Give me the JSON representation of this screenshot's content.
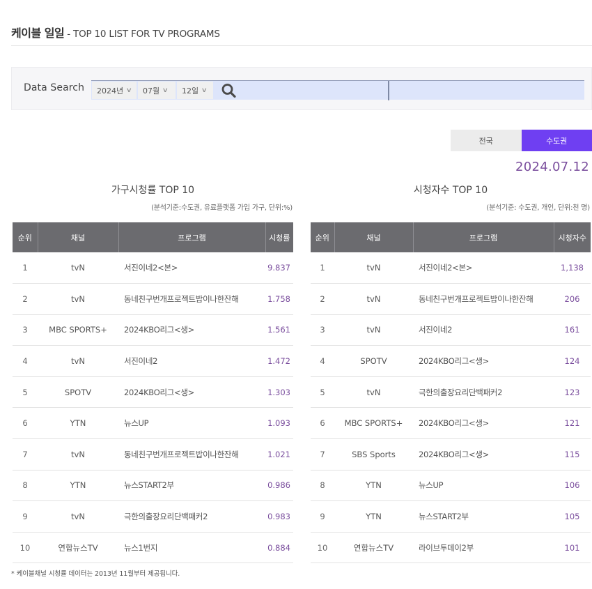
{
  "header": {
    "title": "케이블 일일",
    "subtitle": " - TOP 10 LIST FOR TV PROGRAMS"
  },
  "search": {
    "label": "Data Search",
    "year": "2024년",
    "month": "07월",
    "day": "12일",
    "search_icon": "search-icon"
  },
  "region_tabs": [
    {
      "label": "전국",
      "active": false
    },
    {
      "label": "수도권",
      "active": true
    }
  ],
  "date": "2024.07.12",
  "colors": {
    "accent_purple": "#6f3ff2",
    "value_purple": "#7b4f9e",
    "table_header": "#6b6b6f",
    "search_bar": "#dde5fb"
  },
  "household": {
    "title": "가구시청률 TOP 10",
    "note": "(분석기준:수도권, 유료플랫폼 가입 가구, 단위:%)",
    "columns": [
      "순위",
      "채널",
      "프로그램",
      "시청률"
    ],
    "rows": [
      {
        "rank": "1",
        "channel": "tvN",
        "program": "서진이네2<본>",
        "value": "9.837"
      },
      {
        "rank": "2",
        "channel": "tvN",
        "program": "동네친구번개프로젝트밥이나한잔해",
        "value": "1.758"
      },
      {
        "rank": "3",
        "channel": "MBC SPORTS+",
        "program": "2024KBO리그<생>",
        "value": "1.561"
      },
      {
        "rank": "4",
        "channel": "tvN",
        "program": "서진이네2",
        "value": "1.472"
      },
      {
        "rank": "5",
        "channel": "SPOTV",
        "program": "2024KBO리그<생>",
        "value": "1.303"
      },
      {
        "rank": "6",
        "channel": "YTN",
        "program": "뉴스UP",
        "value": "1.093"
      },
      {
        "rank": "7",
        "channel": "tvN",
        "program": "동네친구번개프로젝트밥이나한잔해",
        "value": "1.021"
      },
      {
        "rank": "8",
        "channel": "YTN",
        "program": "뉴스START2부",
        "value": "0.986"
      },
      {
        "rank": "9",
        "channel": "tvN",
        "program": "극한의출장요리단백패커2",
        "value": "0.983"
      },
      {
        "rank": "10",
        "channel": "연합뉴스TV",
        "program": "뉴스1번지",
        "value": "0.884"
      }
    ]
  },
  "viewers": {
    "title": "시청자수 TOP 10",
    "note": "(분석기준: 수도권, 개인, 단위:천 명)",
    "columns": [
      "순위",
      "채널",
      "프로그램",
      "시청자수"
    ],
    "rows": [
      {
        "rank": "1",
        "channel": "tvN",
        "program": "서진이네2<본>",
        "value": "1,138"
      },
      {
        "rank": "2",
        "channel": "tvN",
        "program": "동네친구번개프로젝트밥이나한잔해",
        "value": "206"
      },
      {
        "rank": "3",
        "channel": "tvN",
        "program": "서진이네2",
        "value": "161"
      },
      {
        "rank": "4",
        "channel": "SPOTV",
        "program": "2024KBO리그<생>",
        "value": "124"
      },
      {
        "rank": "5",
        "channel": "tvN",
        "program": "극한의출장요리단백패커2",
        "value": "123"
      },
      {
        "rank": "6",
        "channel": "MBC SPORTS+",
        "program": "2024KBO리그<생>",
        "value": "121"
      },
      {
        "rank": "7",
        "channel": "SBS Sports",
        "program": "2024KBO리그<생>",
        "value": "115"
      },
      {
        "rank": "8",
        "channel": "YTN",
        "program": "뉴스UP",
        "value": "106"
      },
      {
        "rank": "9",
        "channel": "YTN",
        "program": "뉴스START2부",
        "value": "105"
      },
      {
        "rank": "10",
        "channel": "연합뉴스TV",
        "program": "라이브투데이2부",
        "value": "101"
      }
    ]
  },
  "footnote": "* 케이블채널 시청률 데이터는 2013년 11월부터 제공됩니다."
}
